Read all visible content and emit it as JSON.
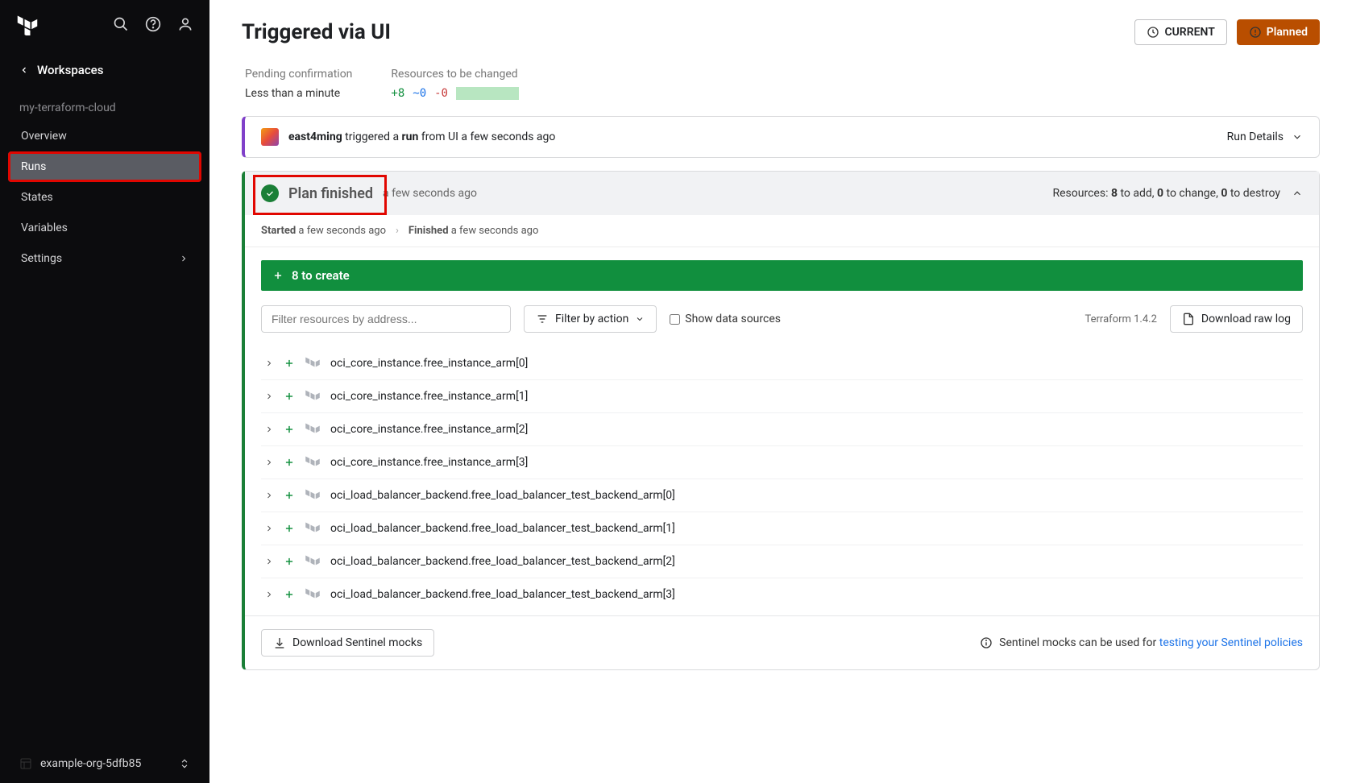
{
  "sidebar": {
    "back_label": "Workspaces",
    "workspace_name": "my-terraform-cloud",
    "items": [
      {
        "label": "Overview"
      },
      {
        "label": "Runs"
      },
      {
        "label": "States"
      },
      {
        "label": "Variables"
      },
      {
        "label": "Settings"
      }
    ],
    "org_label": "example-org-5dfb85"
  },
  "header": {
    "title": "Triggered via UI",
    "current_btn": "CURRENT",
    "planned_btn": "Planned"
  },
  "stats": {
    "pending_label": "Pending confirmation",
    "pending_value": "Less than a minute",
    "resources_label": "Resources to be changed",
    "add": "+8",
    "mod": "~0",
    "del": "-0"
  },
  "triggered": {
    "user": "east4ming",
    "text1": " triggered a ",
    "run": "run",
    "text2": " from UI a few seconds ago",
    "details": "Run Details"
  },
  "plan": {
    "title": "Plan finished",
    "time": "a few seconds ago",
    "summary_prefix": "Resources: ",
    "summary_add": "8",
    "summary_add_t": " to add, ",
    "summary_chg": "0",
    "summary_chg_t": " to change, ",
    "summary_del": "0",
    "summary_del_t": " to destroy",
    "started_label": "Started",
    "started_val": " a few seconds ago",
    "finished_label": "Finished",
    "finished_val": " a few seconds ago",
    "create_banner": "8 to create",
    "filter_placeholder": "Filter resources by address...",
    "filter_action": "Filter by action",
    "show_data": "Show data sources",
    "tf_version": "Terraform 1.4.2",
    "download_raw": "Download raw log",
    "resources": [
      "oci_core_instance.free_instance_arm[0]",
      "oci_core_instance.free_instance_arm[1]",
      "oci_core_instance.free_instance_arm[2]",
      "oci_core_instance.free_instance_arm[3]",
      "oci_load_balancer_backend.free_load_balancer_test_backend_arm[0]",
      "oci_load_balancer_backend.free_load_balancer_test_backend_arm[1]",
      "oci_load_balancer_backend.free_load_balancer_test_backend_arm[2]",
      "oci_load_balancer_backend.free_load_balancer_test_backend_arm[3]"
    ],
    "sentinel_btn": "Download Sentinel mocks",
    "sentinel_note": "Sentinel mocks can be used for ",
    "sentinel_link": "testing your Sentinel policies"
  }
}
